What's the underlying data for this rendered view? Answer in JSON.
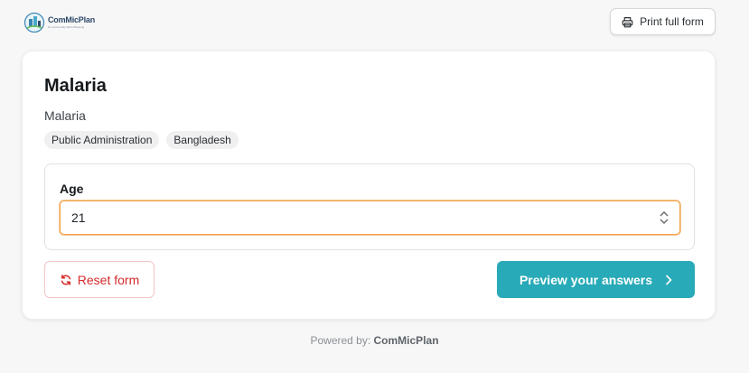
{
  "header": {
    "logo_name": "ComMicPlan",
    "logo_tagline": "for Community Micro Planning",
    "print_label": "Print full form"
  },
  "form": {
    "title": "Malaria",
    "subtitle": "Malaria",
    "tags": [
      "Public Administration",
      "Bangladesh"
    ]
  },
  "question": {
    "label": "Age",
    "value": "21"
  },
  "actions": {
    "reset_label": "Reset form",
    "preview_label": "Preview your answers"
  },
  "footer": {
    "powered_prefix": "Powered by:",
    "powered_name": "ComMicPlan"
  },
  "colors": {
    "accent": "#28aab8",
    "danger": "#d42a2a",
    "focus_border": "#f0a24b"
  },
  "icons": [
    "printer-icon",
    "reset-icon",
    "chevron-right-icon",
    "spin-up-icon",
    "spin-down-icon"
  ]
}
